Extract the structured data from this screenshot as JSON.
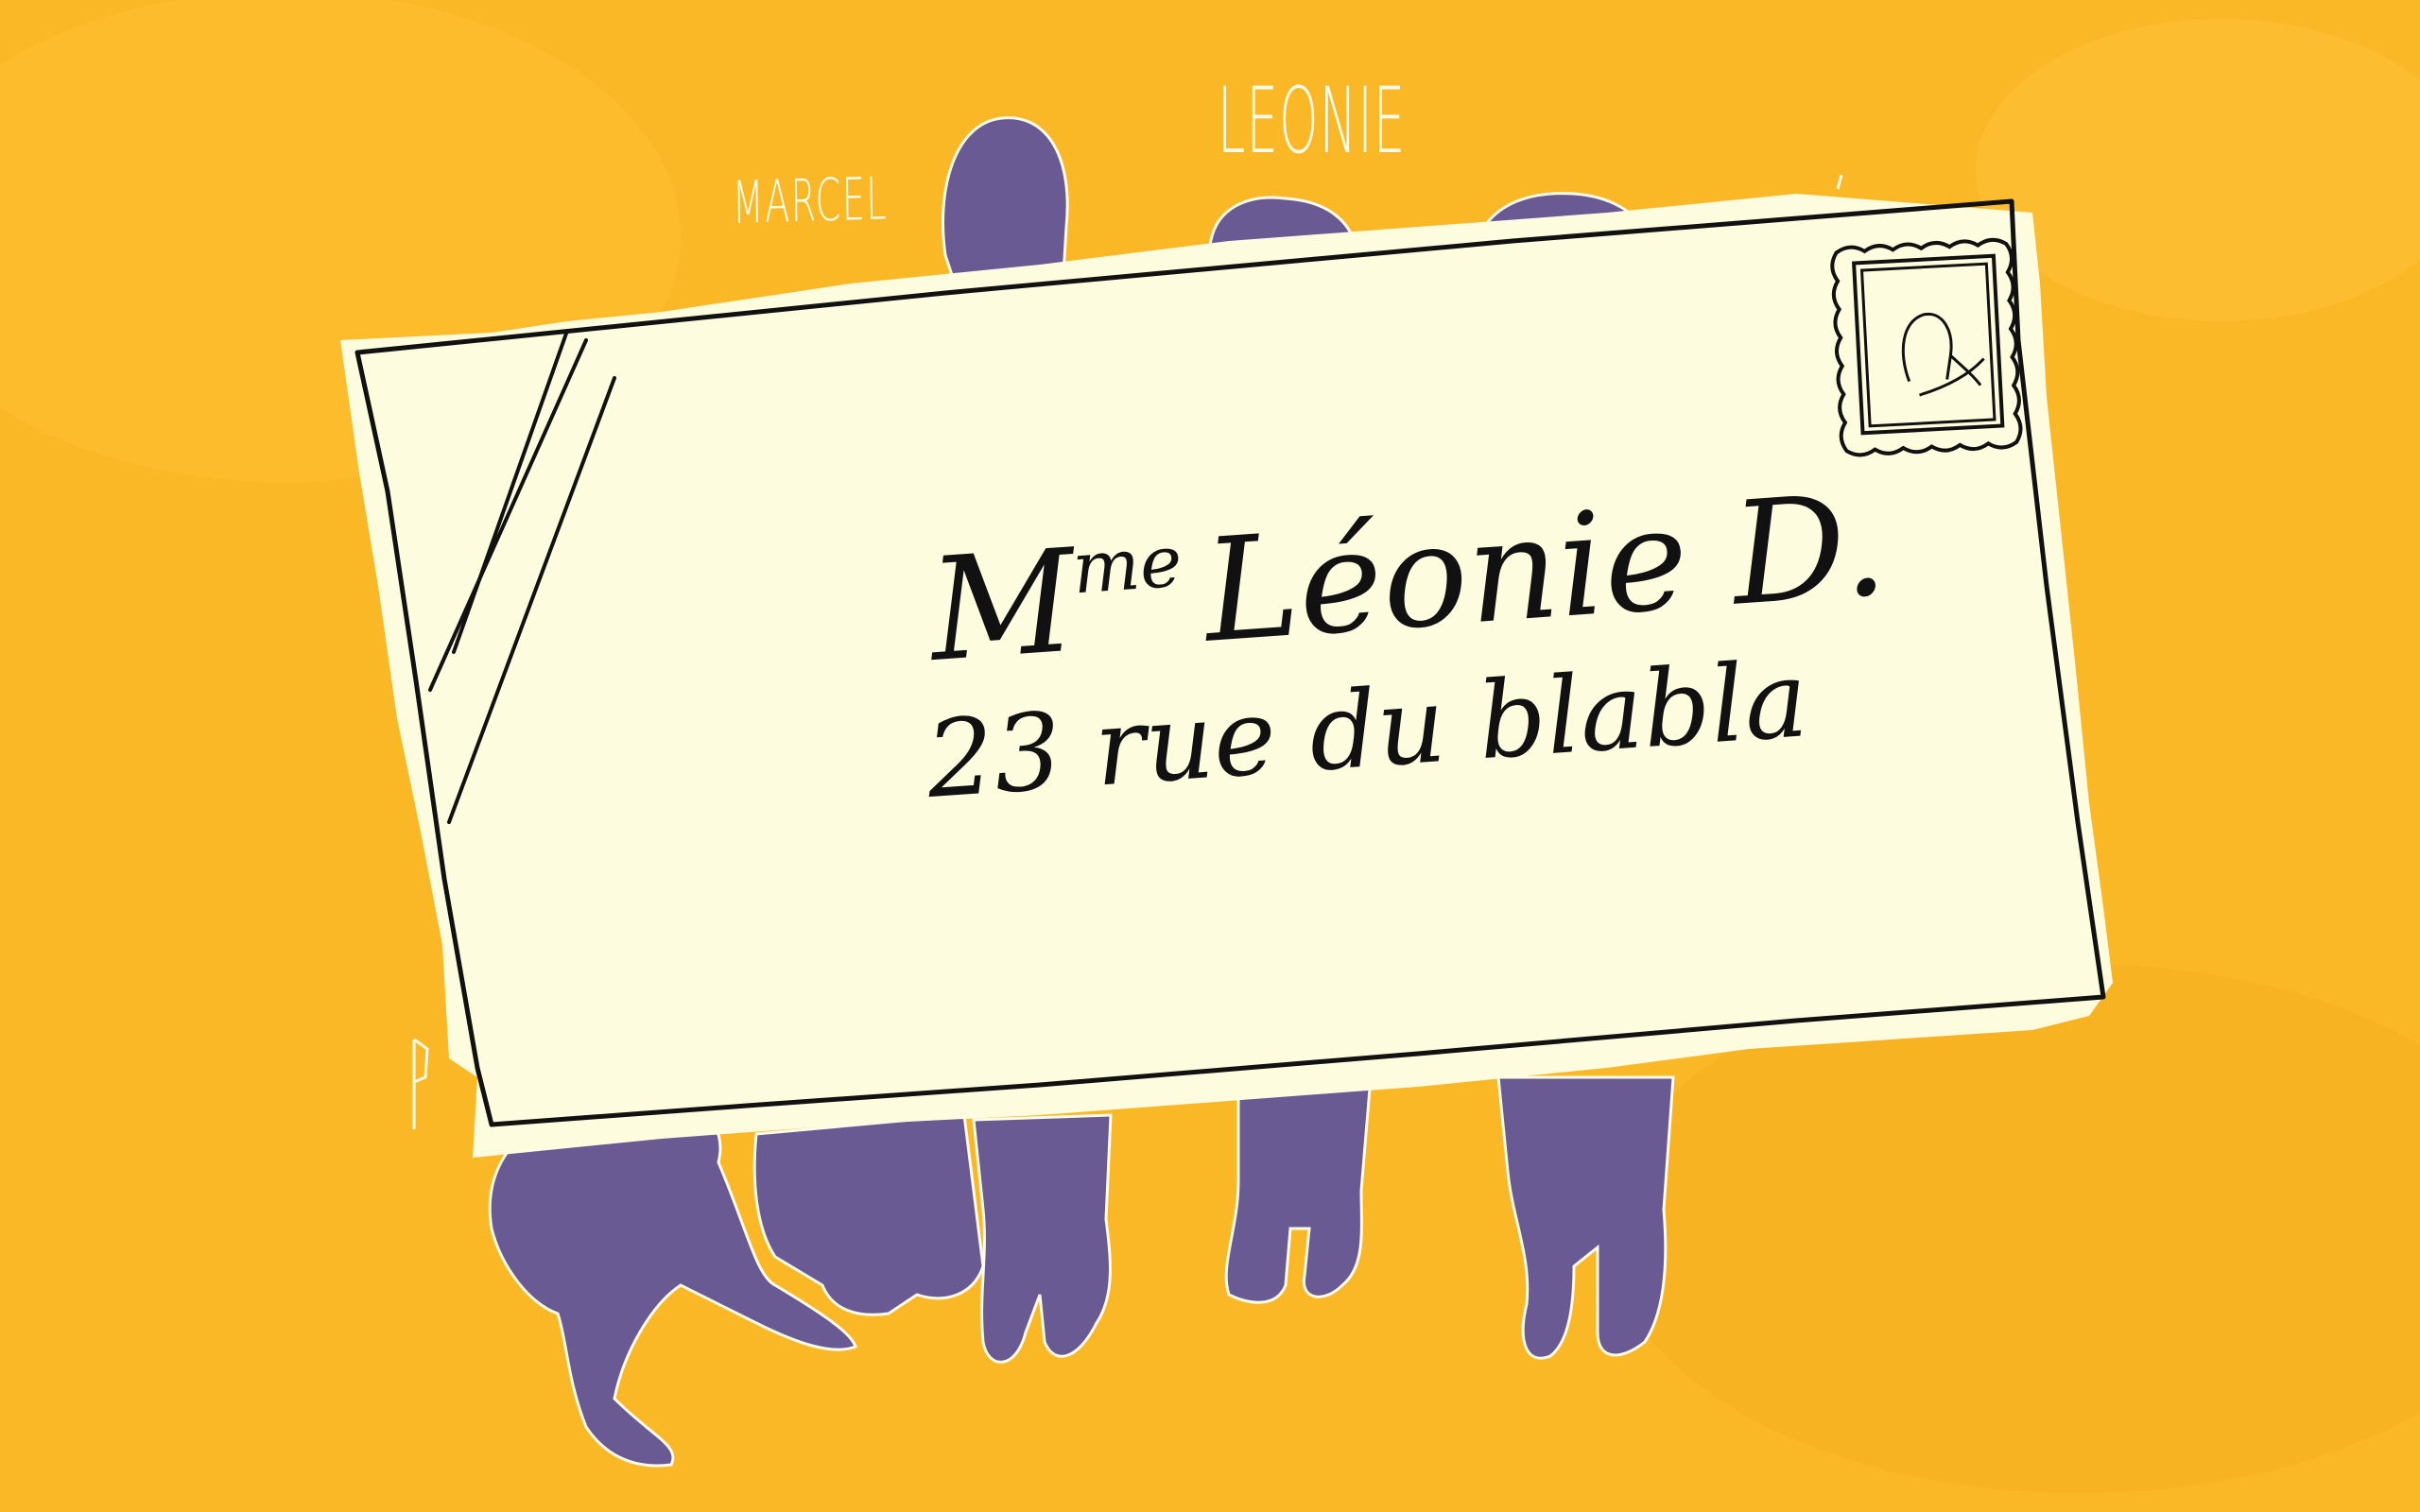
{
  "labels": {
    "marcel": "MARCEL",
    "leonie": "LEONIE"
  },
  "envelope": {
    "recipient_prefix": "M",
    "recipient_prefix_sup": "me",
    "recipient_name": "Léonie D.",
    "street": "23 rue du blabla"
  },
  "icons": {
    "stamp": "postage-stamp-icon"
  },
  "colors": {
    "background": "#fbb826",
    "figures": "#6a5a94",
    "envelope": "#fefcdf",
    "ink": "#111111"
  }
}
